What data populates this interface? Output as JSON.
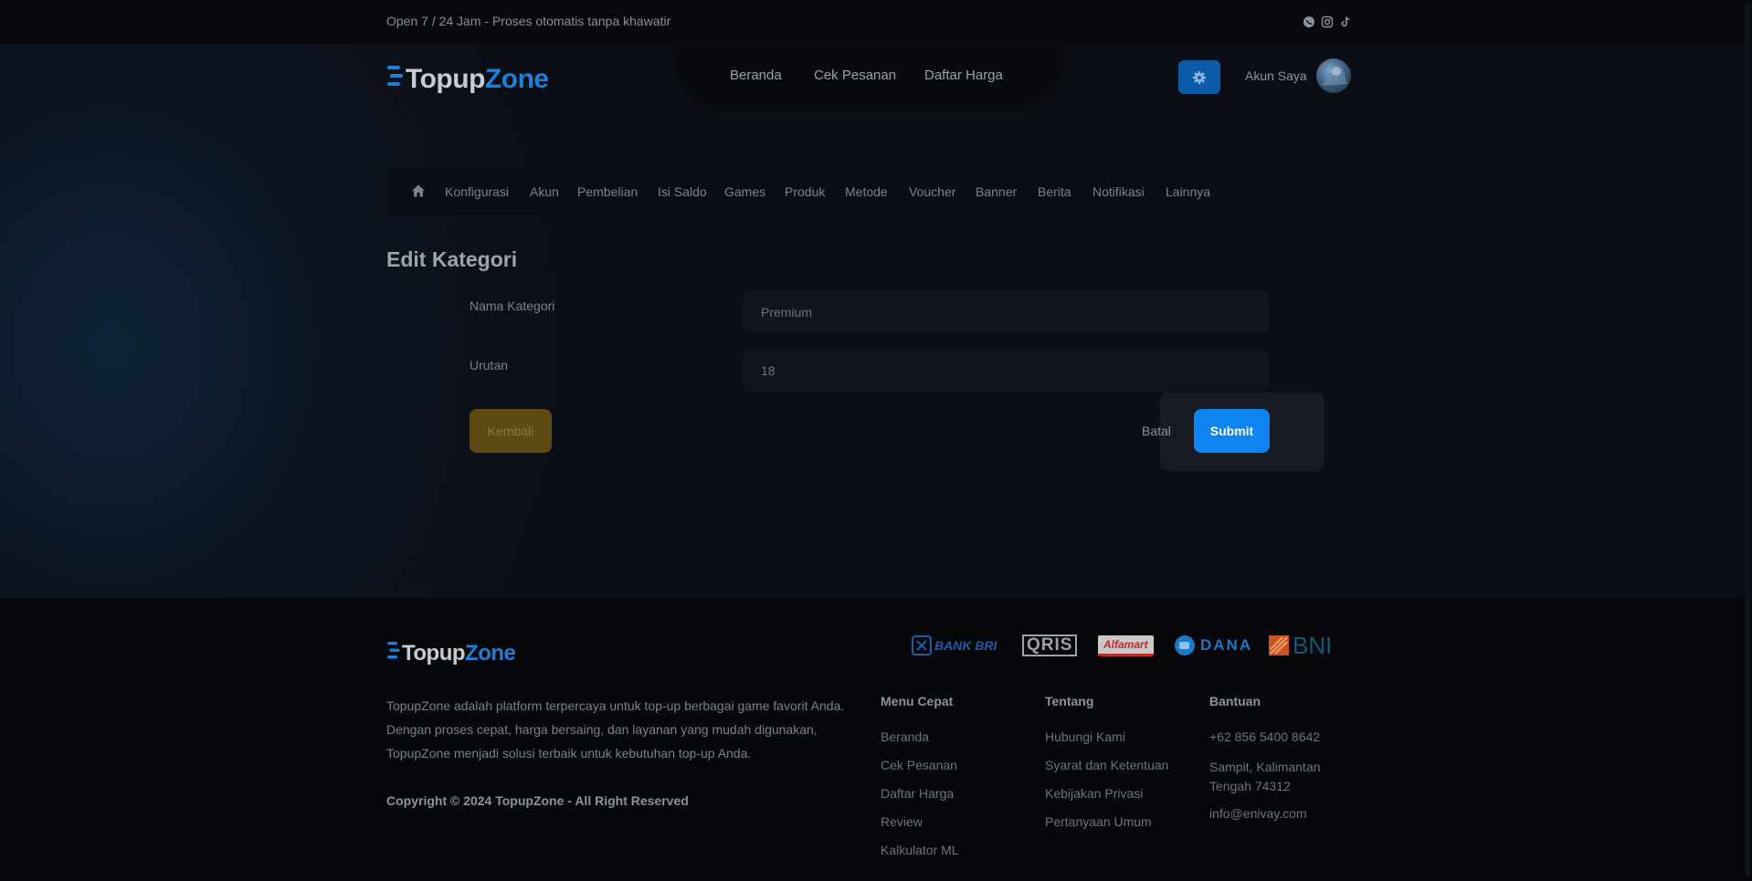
{
  "topbar": {
    "tagline": "Open 7 / 24 Jam - Proses otomatis tanpa khawatir",
    "socials": [
      "whatsapp-icon",
      "instagram-icon",
      "tiktok-icon"
    ]
  },
  "brand": {
    "part_a": "Topup",
    "part_b": "Z",
    "part_c": "ne",
    "accent": "#1e7ed8"
  },
  "nav": {
    "items": [
      "Beranda",
      "Cek Pesanan",
      "Daftar Harga"
    ]
  },
  "account": {
    "label": "Akun Saya",
    "settings_icon": "gear-icon"
  },
  "admin_menu": {
    "home_icon": "home-icon",
    "items": [
      "Konfigurasi",
      "Akun",
      "Pembelian",
      "Isi Saldo",
      "Games",
      "Produk",
      "Metode",
      "Voucher",
      "Banner",
      "Berita",
      "Notifikasi",
      "Lainnya"
    ]
  },
  "form": {
    "title": "Edit Kategori",
    "fields": [
      {
        "label": "Nama Kategori",
        "value": "Premium"
      },
      {
        "label": "Urutan",
        "value": "18"
      }
    ],
    "back_label": "Kembali",
    "cancel_label": "Batal",
    "submit_label": "Submit"
  },
  "footer": {
    "description": "TopupZone adalah platform terpercaya untuk top-up berbagai game favorit Anda. Dengan proses cepat, harga bersaing, dan layanan yang mudah digunakan, TopupZone menjadi solusi terbaik untuk kebutuhan top-up Anda.",
    "copyright": "Copyright © 2024 TopupZone - All Right Reserved",
    "payments": [
      "BANK BRI",
      "QRIS",
      "Alfamart",
      "DANA",
      "BNI"
    ],
    "columns": [
      {
        "heading": "Menu Cepat",
        "links": [
          "Beranda",
          "Cek Pesanan",
          "Daftar Harga",
          "Review",
          "Kalkulator ML"
        ]
      },
      {
        "heading": "Tentang",
        "links": [
          "Hubungi Kami",
          "Syarat dan Ketentuan",
          "Kebijakan Privasi",
          "Pertanyaan Umum"
        ]
      },
      {
        "heading": "Bantuan",
        "links": [
          "+62 856 5400 8642",
          "Sampit, Kalimantan Tengah 74312",
          "info@enivay.com"
        ]
      }
    ]
  }
}
